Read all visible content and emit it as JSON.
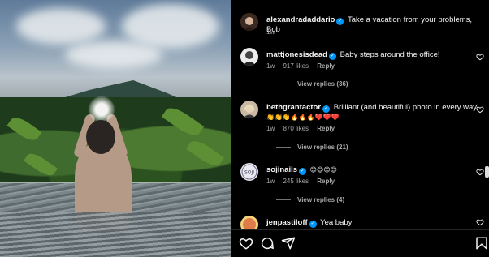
{
  "post": {
    "author": "alexandradaddario",
    "caption": "Take a vacation from your problems, Bob",
    "age": "1w"
  },
  "comments": [
    {
      "username": "mattjonesisdead",
      "text": "Baby steps around the office!",
      "age": "1w",
      "likes": "917 likes",
      "reply": "Reply",
      "view_replies": "View replies (36)"
    },
    {
      "username": "bethgrantactor",
      "text": "Brilliant (and beautiful) photo in every way!",
      "emoji_line": "👏👏👏🔥🔥🔥❤️❤️❤️",
      "age": "1w",
      "likes": "870 likes",
      "reply": "Reply",
      "view_replies": "View replies (21)"
    },
    {
      "username": "sojinails",
      "text": "😍😍😍😍",
      "age": "1w",
      "likes": "245 likes",
      "reply": "Reply",
      "view_replies": "View replies (4)"
    },
    {
      "username": "jenpastiloff",
      "text": "Yea baby"
    }
  ],
  "icons": {
    "like": "heart-icon",
    "comment": "comment-icon",
    "share": "share-icon",
    "save": "bookmark-icon",
    "verified": "verified-badge-icon"
  },
  "colors": {
    "background": "#000000",
    "verified": "#0095f6",
    "secondary_text": "#a8a8a8"
  }
}
